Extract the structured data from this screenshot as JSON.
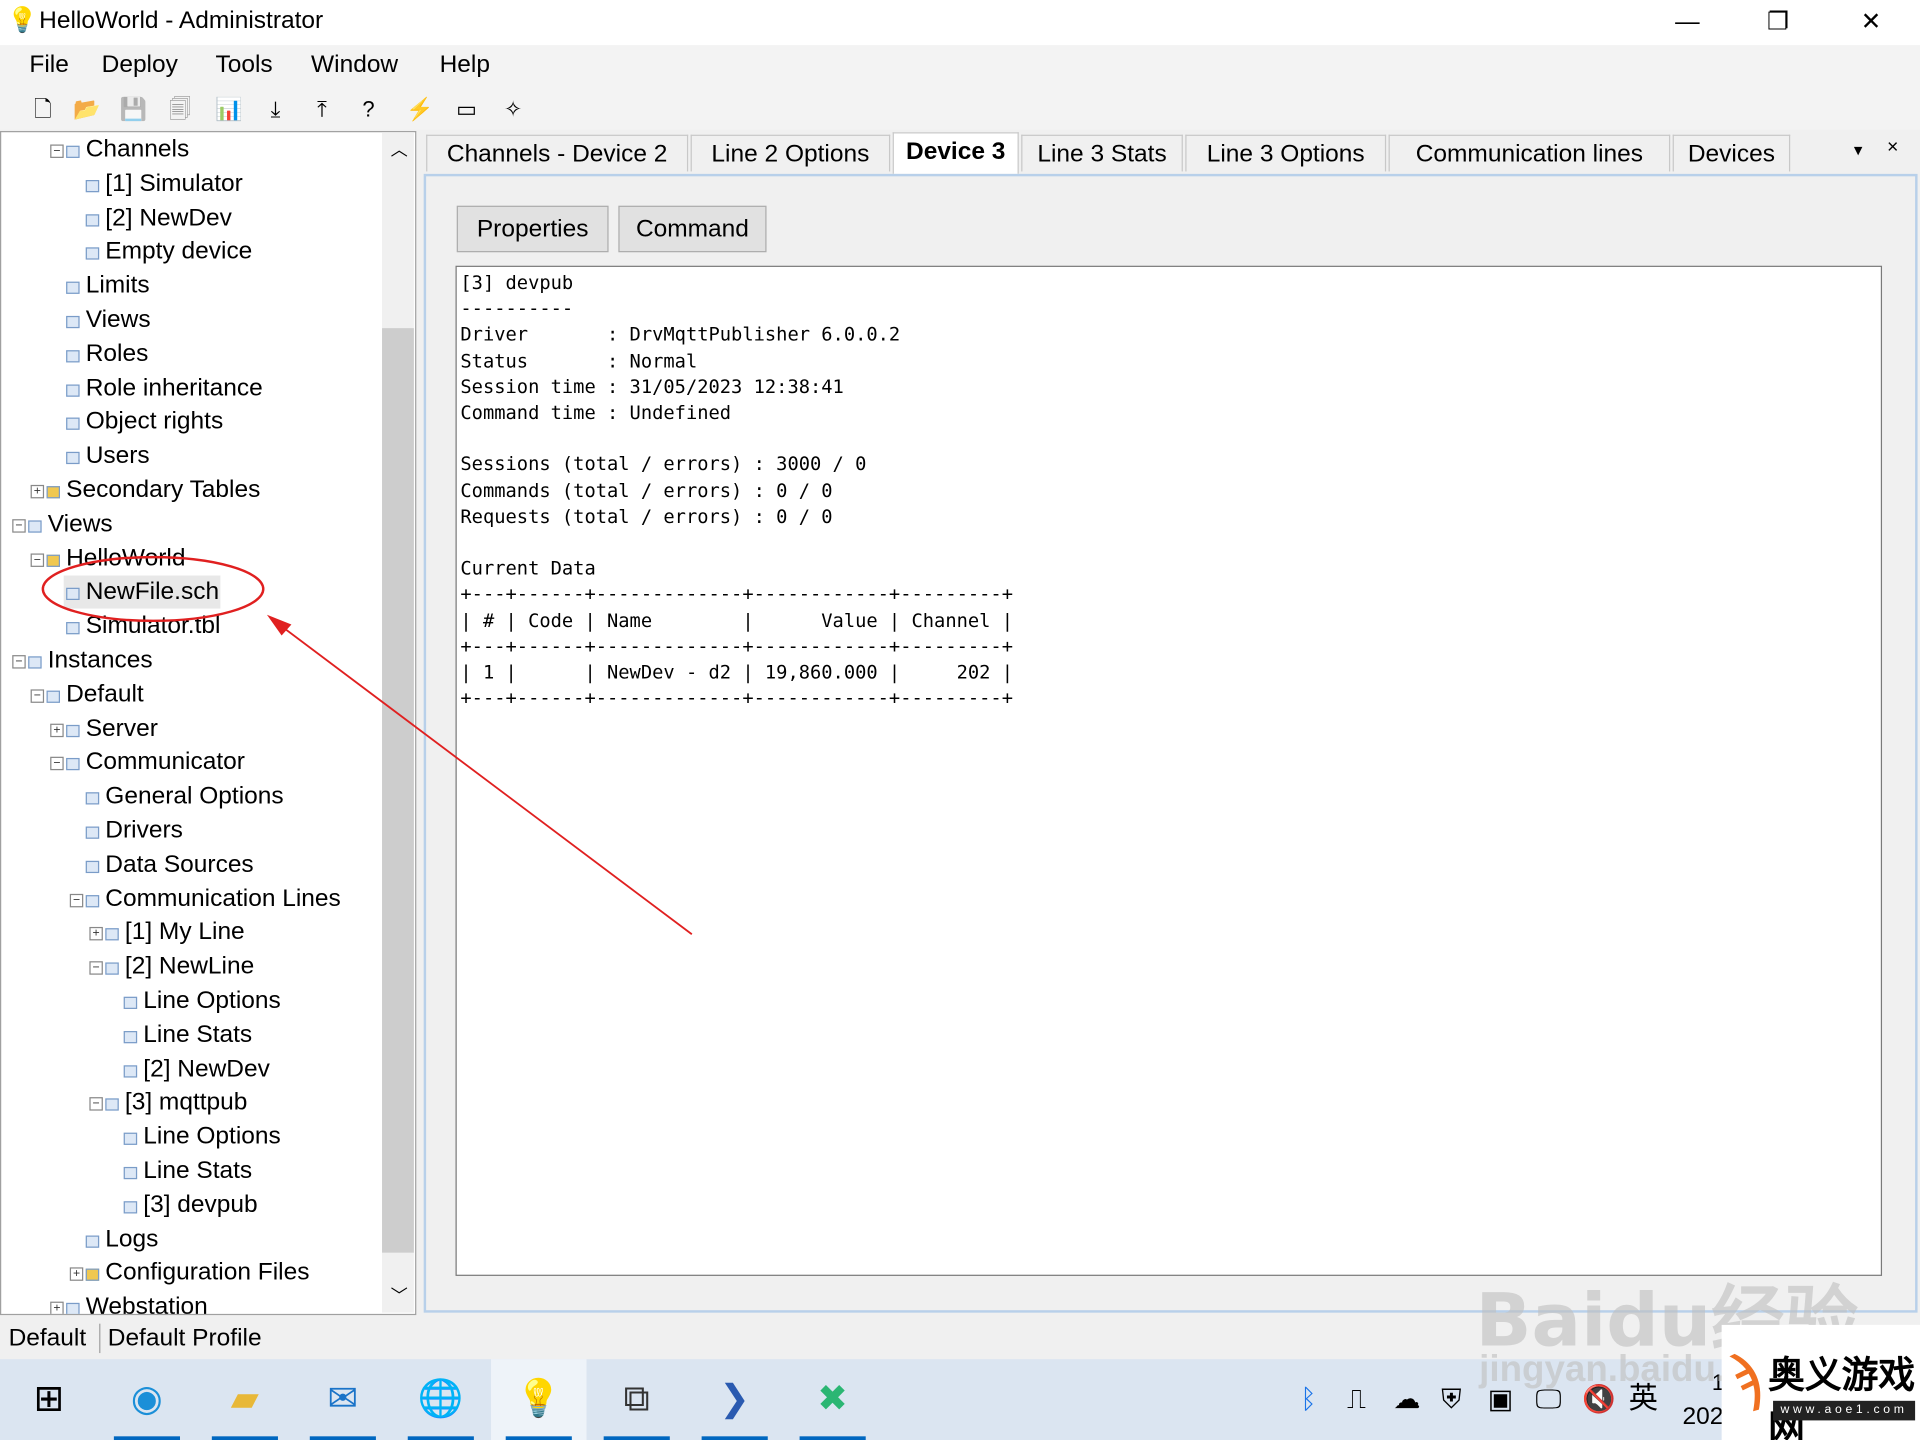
{
  "window": {
    "title": "HelloWorld - Administrator",
    "minimize": "—",
    "maximize": "❐",
    "close": "✕"
  },
  "menu": [
    "File",
    "Deploy",
    "Tools",
    "Window",
    "Help"
  ],
  "toolbar": [
    {
      "icon": "new-file-icon",
      "glyph": "🗋"
    },
    {
      "icon": "open-folder-icon",
      "glyph": "📂"
    },
    {
      "icon": "save-icon",
      "glyph": "💾"
    },
    {
      "icon": "save-all-icon",
      "glyph": "🗐"
    },
    {
      "icon": "chart-icon",
      "glyph": "📊"
    },
    {
      "icon": "download-icon",
      "glyph": "⤓"
    },
    {
      "icon": "upload-icon",
      "glyph": "⤒"
    },
    {
      "icon": "help-icon",
      "glyph": "?"
    },
    {
      "icon": "add-line-icon",
      "glyph": "⚡"
    },
    {
      "icon": "add-device-icon",
      "glyph": "▭"
    },
    {
      "icon": "wizard-icon",
      "glyph": "✧"
    }
  ],
  "tree": [
    {
      "label": "Channels",
      "level": 3,
      "exp": "-",
      "icon": "table-icon"
    },
    {
      "label": "[1] Simulator",
      "level": 4,
      "icon": "table-icon"
    },
    {
      "label": "[2] NewDev",
      "level": 4,
      "icon": "table-icon"
    },
    {
      "label": "Empty device",
      "level": 4,
      "icon": "table-icon"
    },
    {
      "label": "Limits",
      "level": 3,
      "icon": "table-icon"
    },
    {
      "label": "Views",
      "level": 3,
      "icon": "table-icon"
    },
    {
      "label": "Roles",
      "level": 3,
      "icon": "table-icon"
    },
    {
      "label": "Role inheritance",
      "level": 3,
      "icon": "table-icon"
    },
    {
      "label": "Object rights",
      "level": 3,
      "icon": "table-icon"
    },
    {
      "label": "Users",
      "level": 3,
      "icon": "table-icon"
    },
    {
      "label": "Secondary Tables",
      "level": 2,
      "exp": "+",
      "icon": "folder-icon"
    },
    {
      "label": "Views",
      "level": 1,
      "exp": "-",
      "icon": "views-icon"
    },
    {
      "label": "HelloWorld",
      "level": 2,
      "exp": "-",
      "icon": "folder-open-icon"
    },
    {
      "label": "NewFile.sch",
      "level": 3,
      "icon": "file-icon",
      "selected": true
    },
    {
      "label": "Simulator.tbl",
      "level": 3,
      "icon": "file-icon"
    },
    {
      "label": "Instances",
      "level": 1,
      "exp": "-",
      "icon": "instances-icon"
    },
    {
      "label": "Default",
      "level": 2,
      "exp": "-",
      "icon": "instance-icon"
    },
    {
      "label": "Server",
      "level": 3,
      "exp": "+",
      "icon": "globe-icon"
    },
    {
      "label": "Communicator",
      "level": 3,
      "exp": "-",
      "icon": "communicator-icon"
    },
    {
      "label": "General Options",
      "level": 4,
      "icon": "options-icon"
    },
    {
      "label": "Drivers",
      "level": 4,
      "icon": "drivers-icon"
    },
    {
      "label": "Data Sources",
      "level": 4,
      "icon": "database-icon"
    },
    {
      "label": "Communication Lines",
      "level": 4,
      "exp": "-",
      "icon": "lines-icon"
    },
    {
      "label": "[1] My Line",
      "level": 5,
      "exp": "+",
      "icon": "line-icon"
    },
    {
      "label": "[2] NewLine",
      "level": 5,
      "exp": "-",
      "icon": "line-icon"
    },
    {
      "label": "Line Options",
      "level": 6,
      "icon": "options-icon"
    },
    {
      "label": "Line Stats",
      "level": 6,
      "icon": "stats-icon"
    },
    {
      "label": "[2] NewDev",
      "level": 6,
      "icon": "device-icon"
    },
    {
      "label": "[3] mqttpub",
      "level": 5,
      "exp": "-",
      "icon": "line-icon"
    },
    {
      "label": "Line Options",
      "level": 6,
      "icon": "options-icon"
    },
    {
      "label": "Line Stats",
      "level": 6,
      "icon": "stats-icon"
    },
    {
      "label": "[3] devpub",
      "level": 6,
      "icon": "device-icon"
    },
    {
      "label": "Logs",
      "level": 4,
      "icon": "logs-icon"
    },
    {
      "label": "Configuration Files",
      "level": 4,
      "exp": "+",
      "icon": "folder-icon"
    },
    {
      "label": "Webstation",
      "level": 3,
      "exp": "+",
      "icon": "chrome-icon"
    }
  ],
  "tabs": [
    {
      "label": "Channels - Device 2"
    },
    {
      "label": "Line 2 Options"
    },
    {
      "label": "Device 3",
      "active": true
    },
    {
      "label": "Line 3 Stats"
    },
    {
      "label": "Line 3 Options"
    },
    {
      "label": "Communication lines"
    },
    {
      "label": "Devices"
    }
  ],
  "tab_controls": {
    "menu": "▾",
    "close": "×"
  },
  "content": {
    "buttons": {
      "properties": "Properties",
      "command": "Command"
    },
    "device_info": "[3] devpub\n----------\nDriver       : DrvMqttPublisher 6.0.0.2\nStatus       : Normal\nSession time : 31/05/2023 12:38:41\nCommand time : Undefined\n\nSessions (total / errors) : 3000 / 0\nCommands (total / errors) : 0 / 0\nRequests (total / errors) : 0 / 0\n\nCurrent Data\n+---+------+-------------+------------+---------+\n| # | Code | Name        |      Value | Channel |\n+---+------+-------------+------------+---------+\n| 1 |      | NewDev - d2 | 19,860.000 |     202 |\n+---+------+-------------+------------+---------+"
  },
  "status": {
    "instance": "Default",
    "profile": "Default Profile"
  },
  "taskbar": {
    "apps": [
      {
        "icon": "windows-start-icon",
        "glyph": "⊞",
        "color": "#000000"
      },
      {
        "icon": "edge-icon",
        "glyph": "◉",
        "color": "#1b8fd8",
        "ul": true
      },
      {
        "icon": "file-explorer-icon",
        "glyph": "▰",
        "color": "#e8b838",
        "ul": true
      },
      {
        "icon": "mail-icon",
        "glyph": "✉",
        "color": "#1a73c8",
        "ul": true
      },
      {
        "icon": "globe-app-icon",
        "glyph": "🌐",
        "color": "#3a7ab8",
        "ul": true
      },
      {
        "icon": "lightbulb-app-icon",
        "glyph": "💡",
        "color": "#e8c840",
        "ul": true,
        "active": true
      },
      {
        "icon": "network-app-icon",
        "glyph": "⧉",
        "color": "#333333",
        "ul": true
      },
      {
        "icon": "powershell-icon",
        "glyph": "❯",
        "color": "#2a5ab0",
        "ul": true
      },
      {
        "icon": "remote-app-icon",
        "glyph": "✖",
        "color": "#2bb673",
        "ul": true
      }
    ],
    "tray": [
      {
        "icon": "bluetooth-icon",
        "glyph": "ᛒ"
      },
      {
        "icon": "usb-icon",
        "glyph": "⎍"
      },
      {
        "icon": "cloud-off-icon",
        "glyph": "☁"
      },
      {
        "icon": "security-shield-icon",
        "glyph": "⛨"
      },
      {
        "icon": "vmware-icon",
        "glyph": "▣"
      },
      {
        "icon": "network-icon",
        "glyph": "🖵"
      },
      {
        "icon": "volume-muted-icon",
        "glyph": "🔇"
      }
    ],
    "ime": "英",
    "clock_top": "1",
    "clock_bottom": "202"
  },
  "watermark": {
    "baidu": "Baidu经验",
    "baidu_url": "jingyan.baidu.com",
    "aoe_logo": "奥义游戏网",
    "aoe_url": "www.aoe1.com"
  },
  "annotation_color": "#e02020"
}
